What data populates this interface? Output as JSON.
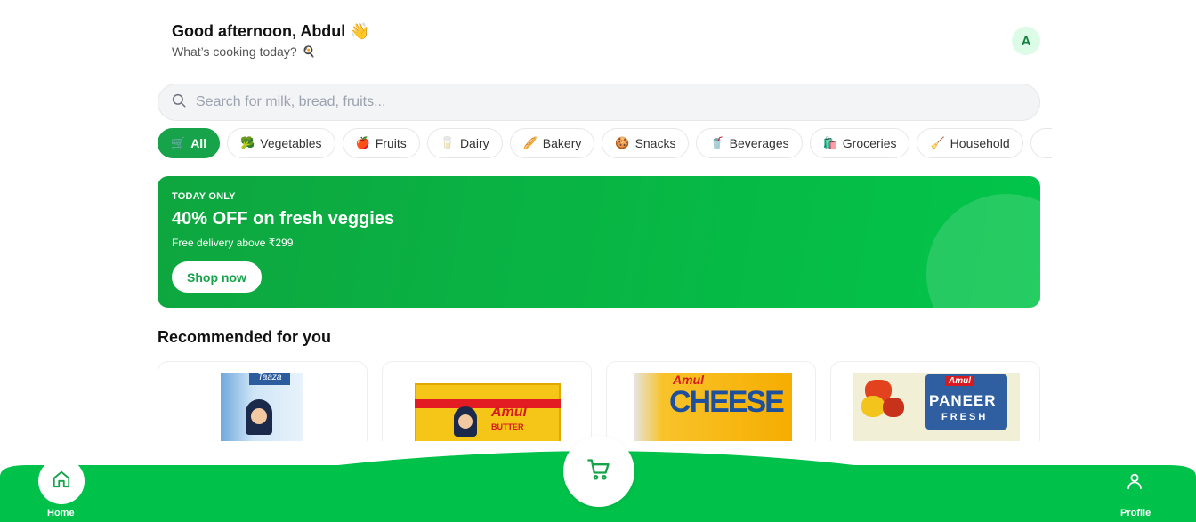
{
  "header": {
    "greeting": "Good afternoon, Abdul 👋",
    "subtitle": "What’s cooking today?",
    "subtitle_emoji": "🍳",
    "avatar_initial": "A"
  },
  "search": {
    "placeholder": "Search for milk, bread, fruits...",
    "icon": "search-icon"
  },
  "categories": [
    {
      "label": "All",
      "emoji": "🛒",
      "active": true
    },
    {
      "label": "Vegetables",
      "emoji": "🥦",
      "active": false
    },
    {
      "label": "Fruits",
      "emoji": "🍎",
      "active": false
    },
    {
      "label": "Dairy",
      "emoji": "🥛",
      "active": false
    },
    {
      "label": "Bakery",
      "emoji": "🥖",
      "active": false
    },
    {
      "label": "Snacks",
      "emoji": "🍪",
      "active": false
    },
    {
      "label": "Beverages",
      "emoji": "🥤",
      "active": false
    },
    {
      "label": "Groceries",
      "emoji": "🛍️",
      "active": false
    },
    {
      "label": "Household",
      "emoji": "🧹",
      "active": false
    }
  ],
  "banner": {
    "tag": "TODAY ONLY",
    "title": "40% OFF on fresh veggies",
    "description": "Free delivery above ₹299",
    "button": "Shop now"
  },
  "recommended": {
    "title": "Recommended for you",
    "products": [
      {
        "brand_text": "Taaza"
      },
      {
        "brand_text": "Amul",
        "sub_text": "BUTTER"
      },
      {
        "brand_text": "Amul",
        "sub_text": "CHEESE"
      },
      {
        "brand_text": "Amul",
        "sub_text": "PANEER",
        "sub_text_2": "FRESH"
      }
    ]
  },
  "bottom_nav": {
    "home_label": "Home",
    "profile_label": "Profile",
    "cart_icon": "cart-icon"
  },
  "colors": {
    "brand_green": "#16a34a",
    "nav_green": "#00c24a"
  }
}
